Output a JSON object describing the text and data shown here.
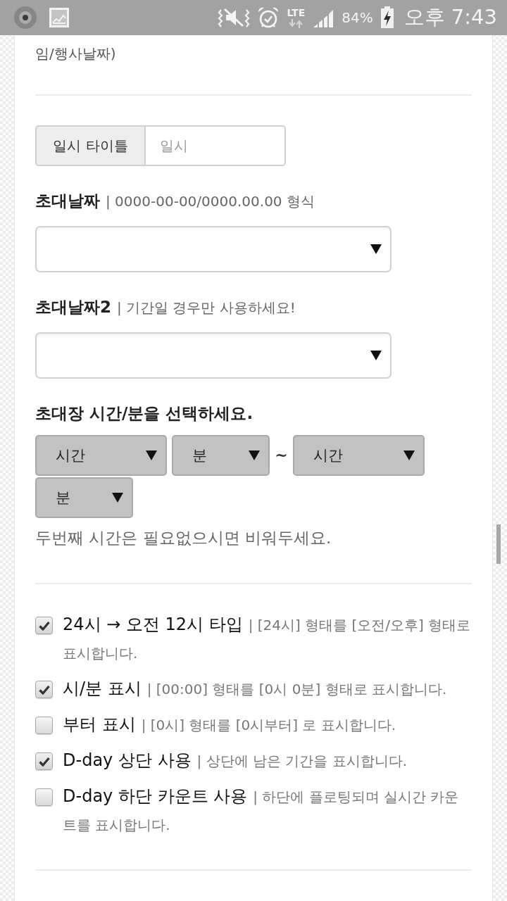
{
  "status_bar": {
    "network": "LTE",
    "battery": "84%",
    "time": "오후 7:43"
  },
  "notice": {
    "text": "임/행사날짜)"
  },
  "title_field": {
    "label": "일시 타이틀",
    "placeholder": "일시"
  },
  "date_fields": [
    {
      "label": "초대날짜",
      "hint": "| 0000-00-00/0000.00.00 형식"
    },
    {
      "label": "초대날짜2",
      "hint": "| 기간일 경우만 사용하세요!"
    }
  ],
  "time_section": {
    "title": "초대장 시간/분을 선택하세요.",
    "controls": [
      {
        "kind": "hour",
        "text": "시간"
      },
      {
        "kind": "minute",
        "text": "분"
      },
      {
        "kind": "separator",
        "text": "~"
      },
      {
        "kind": "hour",
        "text": "시간"
      },
      {
        "kind": "minute",
        "text": "분"
      }
    ],
    "note": "두번째 시간은 필요없으시면 비워두세요."
  },
  "options": [
    {
      "label": "24시 → 오전 12시 타입",
      "description": "| [24시] 형태를 [오전/오후] 형태로 표시합니다.",
      "checked": true
    },
    {
      "label": "시/분 표시",
      "description": "| [00:00] 형태를 [0시 0분] 형태로 표시합니다.",
      "checked": true
    },
    {
      "label": "부터 표시",
      "description": "| [0시] 형태를 [0시부터] 로 표시합니다.",
      "checked": false
    },
    {
      "label": "D-day 상단 사용",
      "description": "| 상단에 남은 기간을 표시합니다.",
      "checked": true
    },
    {
      "label": "D-day 하단 카운트 사용",
      "description": "| 하단에 플로팅되며 실시간 카운트를 표시합니다.",
      "checked": false
    }
  ]
}
